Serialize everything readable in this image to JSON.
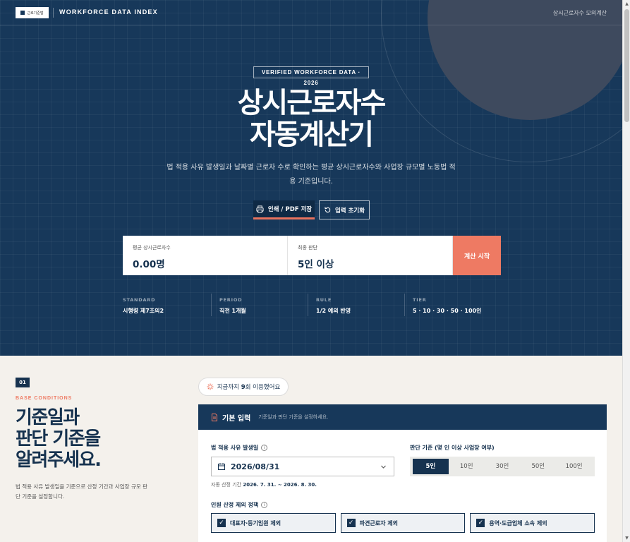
{
  "header": {
    "logo_text": "근로기준법",
    "brand": "WORKFORCE DATA INDEX",
    "nav_link": "상시근로자수 모의계산"
  },
  "hero": {
    "tag": "VERIFIED WORKFORCE DATA · 2026",
    "title_line1": "상시근로자수",
    "title_line2": "자동계산기",
    "description": "법 적용 사유 발생일과 날짜별 근로자 수로 확인하는 평균 상시근로자수와 사업장 규모별 노동법 적용 기준입니다.",
    "print_button": "인쇄 / PDF 저장",
    "reset_button": "입력 초기화"
  },
  "result": {
    "avg_label": "평균 상시근로자수",
    "avg_value": "0.00명",
    "final_label": "최종 판단",
    "final_value": "5인 이상",
    "calc_button": "계산 시작"
  },
  "stats": [
    {
      "key": "STANDARD",
      "value": "시행령 제7조의2"
    },
    {
      "key": "PERIOD",
      "value": "직전 1개월"
    },
    {
      "key": "RULE",
      "value": "1/2 예외 반영"
    },
    {
      "key": "TIER",
      "value": "5 · 10 · 30 · 50 · 100인"
    }
  ],
  "section": {
    "number": "01",
    "eyebrow": "BASE CONDITIONS",
    "title_line1": "기준일과",
    "title_line2": "판단 기준을",
    "title_line3": "알려주세요.",
    "description": "법 적용 사유 발생일을 기준으로 산정 기간과 사업장 규모 판단 기준을 설정합니다."
  },
  "usage": {
    "prefix": "지금까지 ",
    "count": "9",
    "suffix": "회 이용했어요"
  },
  "panel": {
    "title": "기본 입력",
    "subtitle": "기준일과 판단 기준을 설정하세요.",
    "date_label": "법 적용 사유 발생일",
    "date_value": "2026/08/31",
    "hint_prefix": "자동 산정 기간 ",
    "hint_range": "2026. 7. 31. ~ 2026. 8. 30.",
    "criteria_label": "판단 기준 (몇 인 이상 사업장 여부)",
    "criteria_options": [
      "5인",
      "10인",
      "30인",
      "50인",
      "100인"
    ],
    "criteria_selected": "5인",
    "exclusion_label": "인원 산정 제외 정책",
    "exclusions": [
      "대표자·등기임원 제외",
      "파견근로자 제외",
      "용역·도급업체 소속 제외"
    ]
  },
  "colors": {
    "navy": "#17385a",
    "accent": "#ee7a63",
    "background": "#f4f1ec"
  },
  "icons": [
    "printer-icon",
    "reset-icon",
    "sparkle-icon",
    "document-icon",
    "info-icon",
    "calendar-icon",
    "chevron-down-icon",
    "checkbox-checked-icon"
  ]
}
